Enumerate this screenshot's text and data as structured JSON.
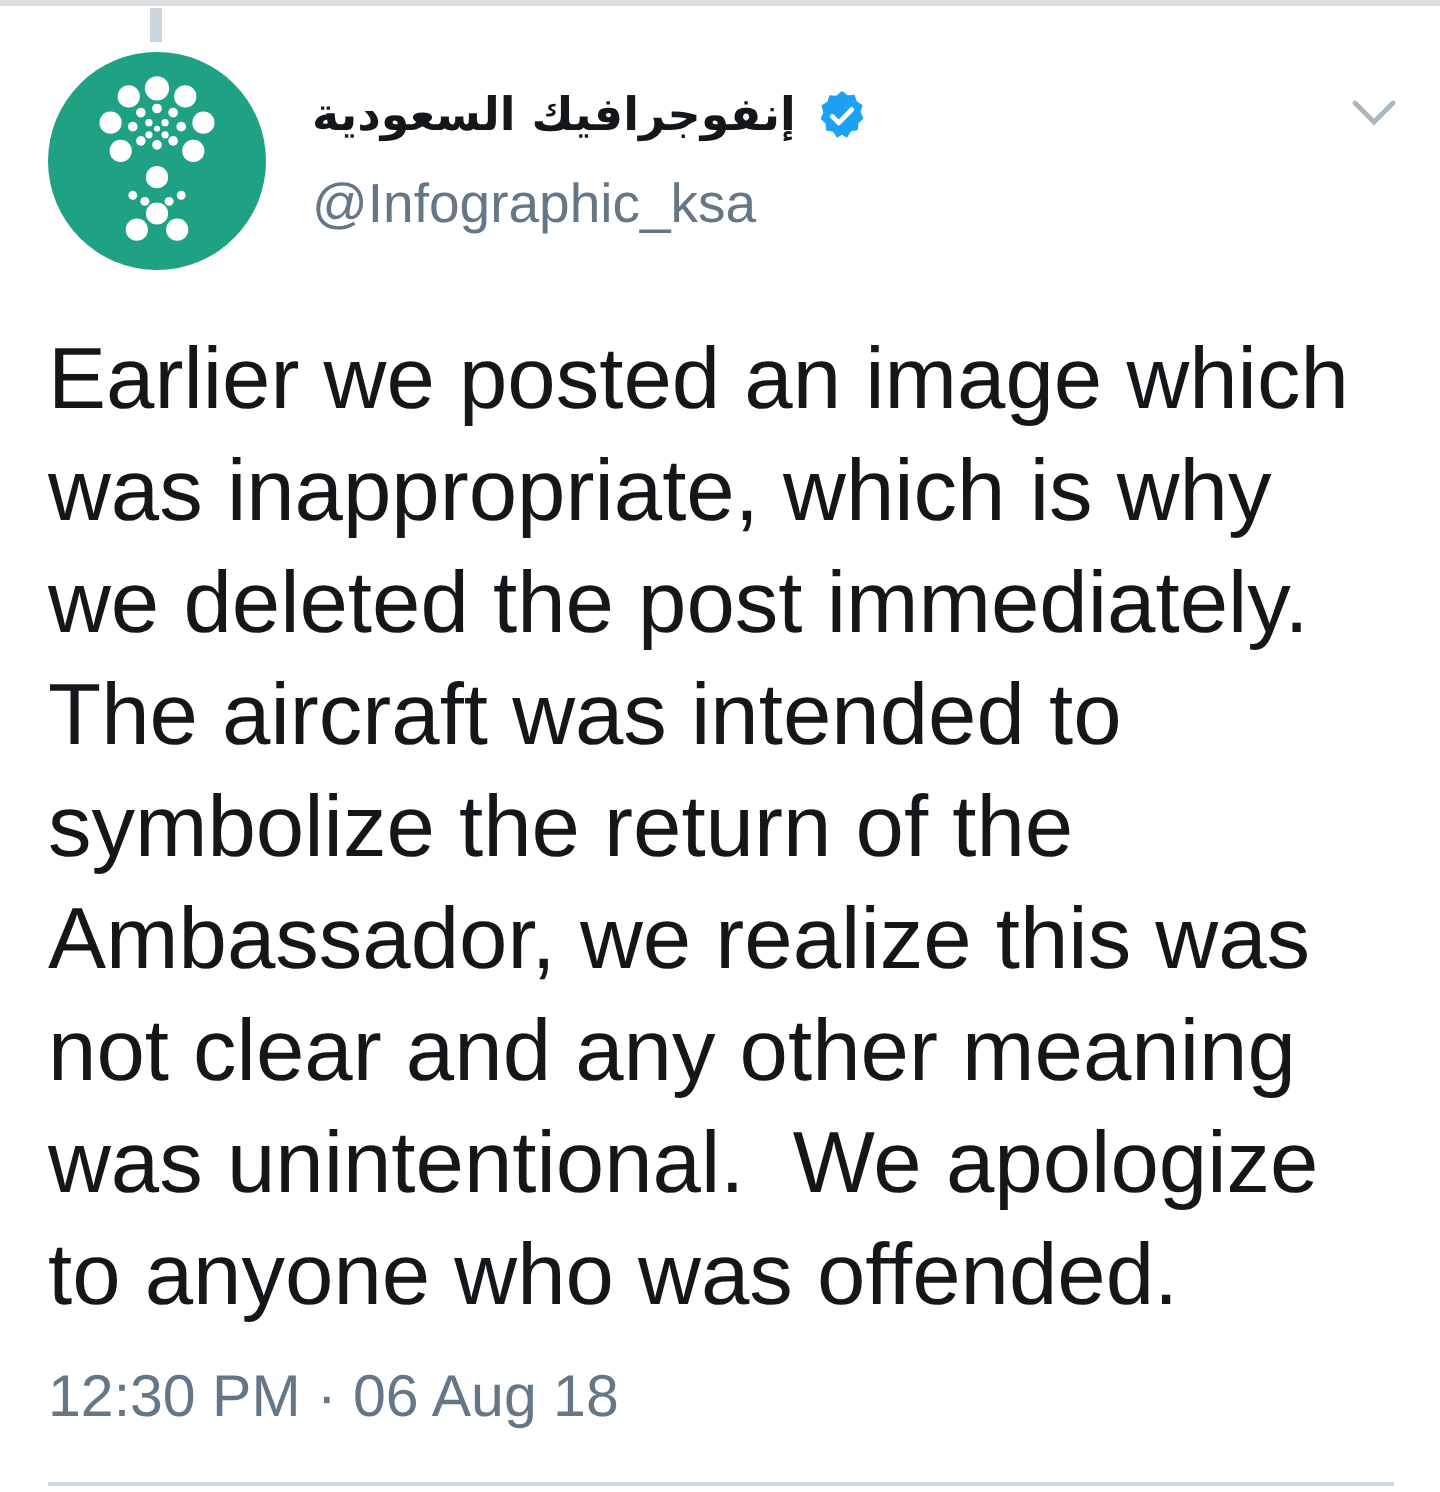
{
  "tweet": {
    "author": {
      "name": "إنفوجرافيك السعودية",
      "verified": true,
      "handle": "@Infographic_ksa"
    },
    "text": "Earlier we posted an image which was inappropriate, which is why we deleted the post immediately. The aircraft was intended to symbolize the return of the Ambassador, we realize this was not clear and any other meaning was unintentional.  We apologize to anyone who was offended.",
    "timestamp": "12:30 PM · 06 Aug 18"
  }
}
